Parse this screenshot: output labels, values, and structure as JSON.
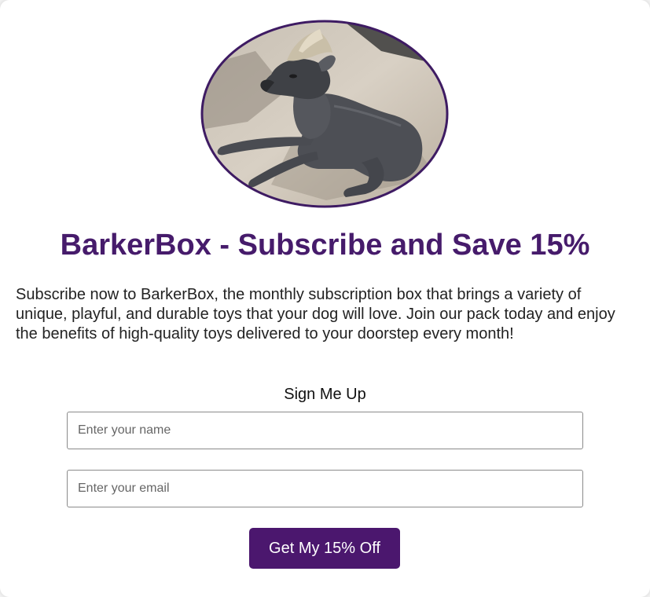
{
  "hero": {
    "image_alt": "hairless dog lying on a sunny pavement"
  },
  "page": {
    "title": "BarkerBox - Subscribe and Save 15%",
    "description": "Subscribe now to BarkerBox, the monthly subscription box that brings a variety of unique, playful, and durable toys that your dog will love. Join our pack today and enjoy the benefits of high-quality toys delivered to your doorstep every month!"
  },
  "form": {
    "heading": "Sign Me Up",
    "name_placeholder": "Enter your name",
    "email_placeholder": "Enter your email",
    "submit_label": "Get My 15% Off"
  },
  "colors": {
    "brand_purple": "#461b6b",
    "button_purple": "#4b176e",
    "image_border": "#3e1b63"
  }
}
